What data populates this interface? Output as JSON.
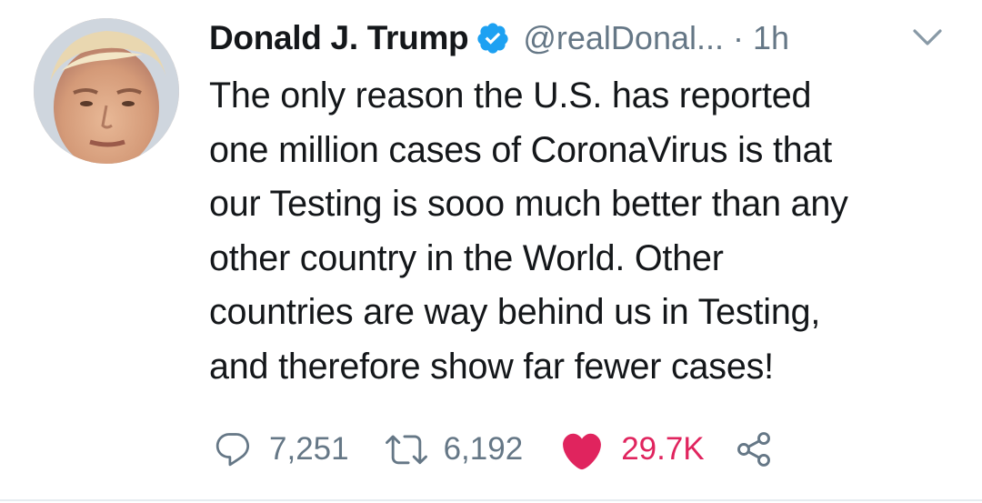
{
  "tweet": {
    "author": {
      "display_name": "Donald J. Trump",
      "handle": "@realDonal...",
      "verified": true,
      "avatar_icon": "profile-photo"
    },
    "separator": "·",
    "time": "1h",
    "menu_icon": "chevron-down-icon",
    "text": "The only reason the U.S. has reported\none million cases of CoronaVirus is that\nour Testing is sooo much better than any\nother country in the World. Other\ncountries are way behind us in Testing,\nand therefore show far fewer cases!",
    "actions": {
      "reply_count": "7,251",
      "retweet_count": "6,192",
      "like_count": "29.7K",
      "liked": true
    }
  },
  "colors": {
    "text_primary": "#14171a",
    "text_secondary": "#657786",
    "verified_blue": "#1da1f2",
    "like_red": "#e0245e"
  }
}
